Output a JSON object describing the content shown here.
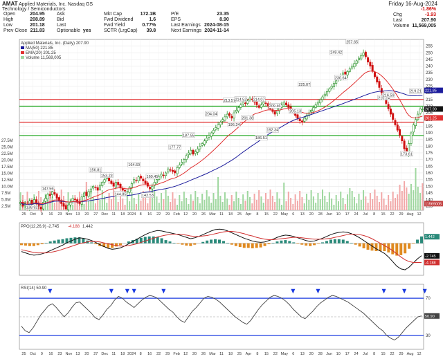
{
  "header": {
    "symbol": "AMAT",
    "company": "Applied Materials, Inc.",
    "exchange": "Nasdaq GS",
    "sector": "Technology / Semiconductors",
    "date": "Friday 16-Aug-2024",
    "col1": [
      [
        "Open",
        "204.95"
      ],
      [
        "High",
        "208.89"
      ],
      [
        "Low",
        "201.18"
      ],
      [
        "Prev Close",
        "211.83"
      ]
    ],
    "col2": [
      [
        "Ask",
        ""
      ],
      [
        "Bid",
        ""
      ],
      [
        "Last",
        ""
      ],
      [
        "Optionable",
        "yes"
      ]
    ],
    "col3": [
      [
        "Mkt Cap",
        "172.1B"
      ],
      [
        "Fwd Dividend",
        "1.6"
      ],
      [
        "Fwd Yield",
        "0.77%"
      ],
      [
        "SCTR (LrgCap)",
        "39.8"
      ]
    ],
    "col4": [
      [
        "P/E",
        "23.35"
      ],
      [
        "EPS",
        "8.90"
      ],
      [
        "Last Earnings",
        "2024-08-15"
      ],
      [
        "Next Earnings",
        "2024-11-14"
      ]
    ],
    "quote": [
      [
        "",
        "-1.86%"
      ],
      [
        "Chg",
        "-3.93"
      ],
      [
        "Last",
        "207.90"
      ],
      [
        "Volume",
        "11,569,005"
      ]
    ]
  },
  "colors": {
    "up": "#1a8a1a",
    "down": "#d01010",
    "ma50": "#1c1c9c",
    "ema20": "#e03030",
    "hline_red": "#e02020",
    "hline_green": "#10a010",
    "macd_hist_pos": "#2a8a7a",
    "macd_hist_neg": "#e08a20",
    "rsi_line": "#444444",
    "rsi_band": "#1a3ae0",
    "rsi_arrow": "#1a3ae0"
  },
  "chart_data": [
    {
      "type": "candlestick",
      "title": "Applied Materials, Inc. (Daily) 207.90",
      "legend": [
        "MA(50) 221.85",
        "EMA(20) 201.25",
        "Volume 11,569,005"
      ],
      "ylim": [
        132,
        260
      ],
      "yticks": [
        "135",
        "140",
        "145",
        "150",
        "155",
        "160",
        "165",
        "170",
        "175",
        "180",
        "185",
        "190",
        "195",
        "200",
        "205",
        "210",
        "215",
        "220",
        "225",
        "230",
        "235",
        "240",
        "245",
        "250",
        "255"
      ],
      "vol_ticks": [
        "2.5M",
        "5.0M",
        "7.5M",
        "10.0M",
        "12.5M",
        "15.0M",
        "17.5M",
        "20.0M",
        "22.5M",
        "25.0M",
        "27.5M"
      ],
      "price_labels": {
        "last": "207.90",
        "ma50": "221.85",
        "ema20": "201.25",
        "volume": "11569005"
      },
      "xticks": [
        "25",
        "Oct",
        "9",
        "16",
        "23",
        "Nov",
        "13",
        "20",
        "27",
        "Dec",
        "11",
        "18",
        "2024",
        "8",
        "16",
        "22",
        "29",
        "Feb",
        "12",
        "20",
        "26",
        "Mar",
        "11",
        "18",
        "25",
        "Apr",
        "8",
        "15",
        "22",
        "May",
        "6",
        "13",
        "20",
        "28",
        "Jun",
        "10",
        "17",
        "24",
        "Jul",
        "8",
        "15",
        "22",
        "29",
        "Aug",
        "12"
      ],
      "hlines": [
        {
          "y": 215,
          "color": "red"
        },
        {
          "y": 210,
          "color": "green"
        },
        {
          "y": 198,
          "color": "red"
        },
        {
          "y": 188,
          "color": "green"
        }
      ],
      "closes": [
        138,
        135,
        137,
        134,
        139,
        136,
        140,
        137,
        135,
        133,
        138,
        141,
        144,
        143,
        146,
        144,
        141,
        139,
        137,
        135,
        133,
        136,
        138,
        141,
        140,
        138,
        137,
        142,
        145,
        143,
        146,
        148,
        150,
        149,
        147,
        151,
        153,
        155,
        157,
        154,
        152,
        150,
        153,
        151,
        149,
        147,
        145,
        146,
        149,
        152,
        155,
        154,
        157,
        156,
        154,
        152,
        150,
        148,
        150,
        153,
        155,
        157,
        159,
        158,
        160,
        163,
        162,
        161,
        160,
        164,
        166,
        168,
        170,
        173,
        175,
        177,
        174,
        176,
        178,
        180,
        182,
        184,
        186,
        188,
        190,
        192,
        194,
        196,
        198,
        200,
        202,
        204,
        203,
        201,
        205,
        207,
        209,
        211,
        213,
        212,
        214,
        216,
        215,
        213,
        211,
        209,
        211,
        213,
        212,
        210,
        208,
        206,
        204,
        207,
        209,
        211,
        213,
        211,
        209,
        207,
        205,
        203,
        201,
        199,
        198,
        201,
        203,
        205,
        207,
        209,
        211,
        213,
        215,
        217,
        219,
        221,
        223,
        225,
        227,
        229,
        231,
        233,
        235,
        234,
        236,
        238,
        240,
        242,
        244,
        246,
        248,
        250,
        247,
        243,
        240,
        236,
        232,
        228,
        224,
        220,
        216,
        212,
        208,
        204,
        200,
        196,
        192,
        188,
        184,
        178,
        174,
        182,
        190,
        196,
        200,
        204,
        208,
        207.9
      ],
      "annotations": [
        [
          "147.56",
          12,
          147
        ],
        [
          "138.92",
          5,
          133
        ],
        [
          "156.81",
          33,
          161
        ],
        [
          "153.23",
          38,
          157
        ],
        [
          "164.60",
          50,
          165
        ],
        [
          "144.85",
          44,
          143
        ],
        [
          "142.53",
          56,
          142
        ],
        [
          "160.45",
          58,
          156
        ],
        [
          "177.77",
          68,
          178
        ],
        [
          "187.55",
          74,
          187
        ],
        [
          "204.04",
          84,
          203
        ],
        [
          "213.57",
          92,
          213
        ],
        [
          "214.52",
          97,
          214
        ],
        [
          "196.24",
          94,
          195
        ],
        [
          "201.38",
          100,
          200
        ],
        [
          "214.07",
          105,
          214
        ],
        [
          "209.46",
          112,
          209
        ],
        [
          "186.51",
          106,
          185
        ],
        [
          "192.34",
          111,
          191
        ],
        [
          "225.07",
          125,
          225
        ],
        [
          "205.13",
          121,
          205
        ],
        [
          "249.42",
          139,
          249
        ],
        [
          "230.64",
          141,
          230
        ],
        [
          "257.65",
          146,
          257
        ],
        [
          "215.24",
          160,
          215
        ],
        [
          "173.61",
          170,
          173
        ],
        [
          "216.59",
          162,
          217
        ],
        [
          "219.21",
          174,
          220
        ]
      ],
      "rsi_arrows": [
        13,
        40,
        47,
        50,
        63,
        120,
        131,
        160,
        169,
        178
      ]
    },
    {
      "type": "line",
      "title": "PPO(12,26,9) -2.745, -4.188, 1.442",
      "legend": [
        "PPO(12,26,9) -2.745",
        "-4.188",
        "1.442"
      ],
      "ylim": [
        -7,
        4.5
      ],
      "price_labels": [
        "1.442",
        "-2.745",
        "-4.188"
      ],
      "ppo": [
        -1.8,
        -2.1,
        -2.4,
        -2.6,
        -2.5,
        -2.3,
        -2.0,
        -1.6,
        -1.2,
        -0.8,
        -0.4,
        0.1,
        0.5,
        0.9,
        1.2,
        1.1,
        0.9,
        0.6,
        0.2,
        -0.3,
        -0.7,
        -1.1,
        -1.3,
        -1.2,
        -1.0,
        -0.6,
        -0.1,
        0.4,
        0.9,
        1.4,
        1.9,
        2.3,
        2.6,
        2.8,
        2.7,
        2.5,
        2.3,
        2.1,
        1.9,
        1.6,
        1.3,
        1.0,
        1.2,
        1.5,
        1.9,
        2.3,
        2.7,
        3.0,
        3.1,
        3.0,
        2.7,
        2.3,
        1.9,
        1.5,
        1.1,
        0.8,
        0.5,
        0.3,
        0.2,
        0.3,
        0.6,
        0.9,
        1.3,
        1.6,
        1.8,
        1.7,
        1.5,
        1.2,
        0.9,
        0.6,
        0.4,
        0.5,
        0.8,
        1.1,
        1.5,
        1.9,
        2.2,
        2.4,
        2.5,
        2.4,
        2.1,
        1.7,
        1.2,
        0.6,
        0.0,
        -0.6,
        -1.2,
        -1.7,
        -2.2,
        -3.0,
        -4.0,
        -5.0,
        -5.6,
        -5.8,
        -5.2,
        -4.3,
        -3.4,
        -2.7
      ],
      "signal": [
        -1.4,
        -1.6,
        -1.8,
        -2.0,
        -2.1,
        -2.1,
        -2.1,
        -2.0,
        -1.8,
        -1.6,
        -1.3,
        -1.0,
        -0.7,
        -0.4,
        -0.1,
        0.1,
        0.3,
        0.4,
        0.4,
        0.3,
        0.1,
        -0.1,
        -0.3,
        -0.5,
        -0.6,
        -0.6,
        -0.5,
        -0.3,
        -0.1,
        0.2,
        0.5,
        0.8,
        1.1,
        1.4,
        1.6,
        1.8,
        1.9,
        2.0,
        2.0,
        1.9,
        1.8,
        1.6,
        1.5,
        1.5,
        1.6,
        1.7,
        1.9,
        2.1,
        2.3,
        2.5,
        2.6,
        2.6,
        2.5,
        2.3,
        2.1,
        1.8,
        1.6,
        1.3,
        1.1,
        0.9,
        0.8,
        0.8,
        0.9,
        1.0,
        1.1,
        1.2,
        1.3,
        1.3,
        1.2,
        1.1,
        1.0,
        0.9,
        0.9,
        0.9,
        1.0,
        1.1,
        1.3,
        1.5,
        1.7,
        1.9,
        2.0,
        2.0,
        1.9,
        1.7,
        1.4,
        1.0,
        0.5,
        0.0,
        -0.5,
        -1.0,
        -1.6,
        -2.3,
        -3.0,
        -3.6,
        -4.0,
        -4.2,
        -4.2,
        -4.2
      ]
    },
    {
      "type": "line",
      "title": "RSI(14) 50.90",
      "legend": [
        "RSI(14) 50.90"
      ],
      "ylim": [
        15,
        85
      ],
      "yticks": [
        "30",
        "50",
        "70"
      ],
      "price_labels": [
        "50.90"
      ],
      "bands": [
        70,
        30
      ],
      "rsi": [
        40,
        35,
        33,
        38,
        45,
        52,
        57,
        62,
        64,
        60,
        55,
        50,
        54,
        60,
        65,
        66,
        62,
        58,
        54,
        49,
        47,
        52,
        58,
        62,
        68,
        72,
        70,
        66,
        63,
        60,
        64,
        68,
        71,
        73,
        72,
        70,
        66,
        62,
        58,
        55,
        50,
        46,
        44,
        50,
        56,
        60,
        65,
        70,
        72,
        71,
        69,
        66,
        62,
        58,
        54,
        50,
        47,
        44,
        42,
        46,
        52,
        58,
        63,
        67,
        71,
        73,
        72,
        70,
        67,
        63,
        58,
        54,
        50,
        48,
        52,
        56,
        61,
        65,
        68,
        71,
        73,
        72,
        70,
        68,
        66,
        63,
        60,
        57,
        54,
        50,
        46,
        42,
        38,
        35,
        30,
        27,
        25,
        28,
        33,
        38,
        42,
        46,
        50,
        51
      ]
    }
  ]
}
